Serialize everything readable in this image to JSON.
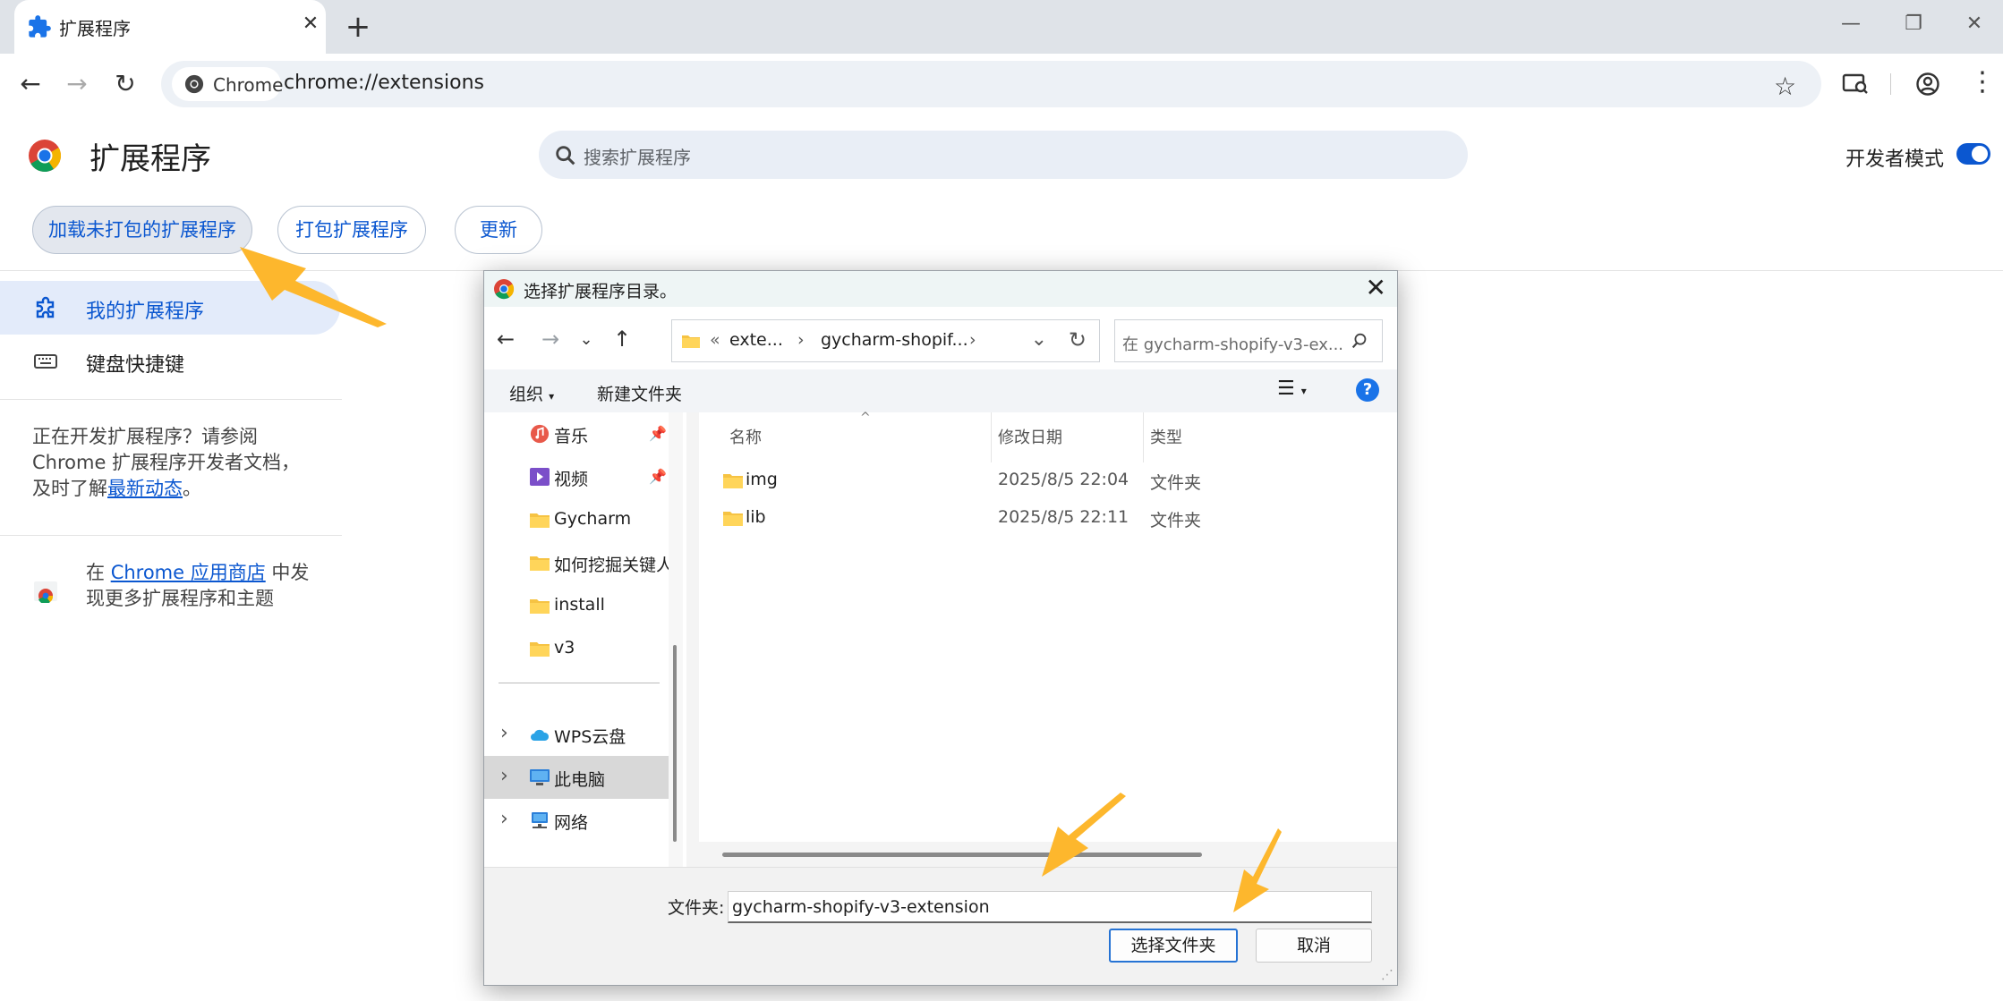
{
  "browser": {
    "tab_title": "扩展程序",
    "tab_close": "✕",
    "new_tab": "+",
    "window_controls": {
      "minimize": "—",
      "maximize": "❐",
      "close": "✕"
    },
    "chip_label": "Chrome",
    "url": "chrome://extensions",
    "icons": [
      "back-arrow-icon",
      "forward-arrow-icon",
      "reload-icon",
      "star-icon",
      "tab-search-icon",
      "profile-icon",
      "menu-dots-icon"
    ]
  },
  "page": {
    "title": "扩展程序",
    "search_placeholder": "搜索扩展程序",
    "dev_mode_label": "开发者模式",
    "dev_mode_on": true,
    "buttons": {
      "load_unpacked": "加载未打包的扩展程序",
      "pack": "打包扩展程序",
      "update": "更新"
    },
    "sidebar": {
      "items": [
        {
          "label": "我的扩展程序",
          "active": true
        },
        {
          "label": "键盘快捷键",
          "active": false
        }
      ],
      "dev_text_1": "正在开发扩展程序？请参阅",
      "dev_text_2": "Chrome 扩展程序开发者文档，",
      "dev_text_3": "及时了解",
      "dev_link": "最新动态",
      "dev_text_end": "。",
      "store_prefix": "在 ",
      "store_link": "Chrome 应用商店",
      "store_suffix": " 中发",
      "store_line2": "现更多扩展程序和主题"
    },
    "accent_color": "#0b57d0"
  },
  "dialog": {
    "title": "选择扩展程序目录。",
    "close": "✕",
    "breadcrumb": {
      "prefix": "«",
      "seg1": "exte...",
      "sep": "›",
      "seg2": "gycharm-shopif..."
    },
    "search_placeholder": "在 gycharm-shopify-v3-ex...",
    "organize": "组织",
    "new_folder": "新建文件夹",
    "help": "?",
    "nav_items": [
      {
        "label": "音乐",
        "icon": "music-icon",
        "pinned": true
      },
      {
        "label": "视频",
        "icon": "video-icon",
        "pinned": true
      },
      {
        "label": "Gycharm",
        "icon": "folder-icon"
      },
      {
        "label": "如何挖掘关键人",
        "icon": "folder-icon"
      },
      {
        "label": "install",
        "icon": "folder-icon"
      },
      {
        "label": "v3",
        "icon": "folder-icon"
      },
      {
        "label": "WPS云盘",
        "icon": "cloud-icon",
        "expandable": true
      },
      {
        "label": "此电脑",
        "icon": "computer-icon",
        "expandable": true,
        "selected": true
      },
      {
        "label": "网络",
        "icon": "network-icon",
        "expandable": true
      }
    ],
    "columns": {
      "name": "名称",
      "modified": "修改日期",
      "type": "类型"
    },
    "files": [
      {
        "name": "img",
        "modified": "2025/8/5 22:04",
        "type": "文件夹"
      },
      {
        "name": "lib",
        "modified": "2025/8/5 22:11",
        "type": "文件夹"
      }
    ],
    "folder_label": "文件夹:",
    "folder_value": "gycharm-shopify-v3-extension",
    "select_button": "选择文件夹",
    "cancel_button": "取消"
  }
}
